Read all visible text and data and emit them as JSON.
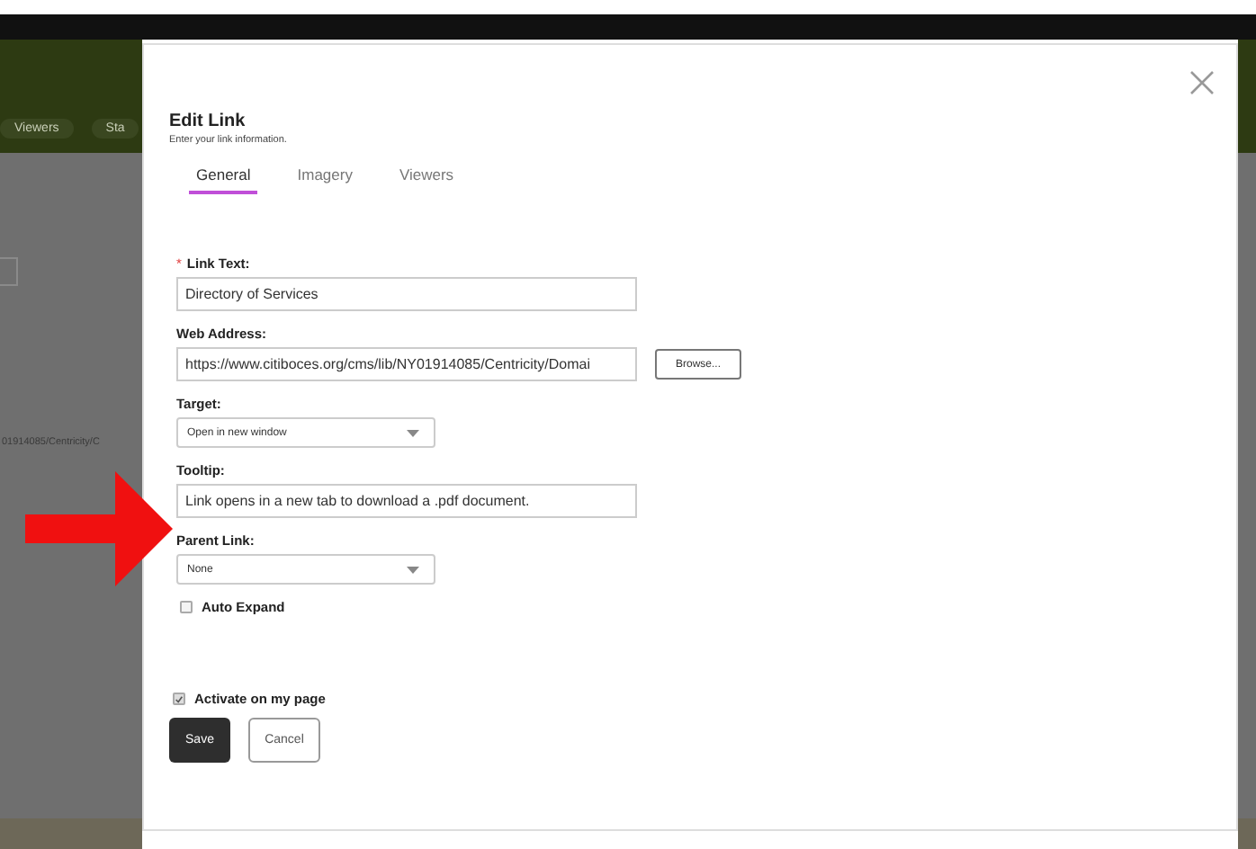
{
  "background": {
    "nav_tabs": [
      "Viewers",
      "Sta"
    ],
    "path_text": "01914085/Centricity/C"
  },
  "dialog": {
    "title": "Edit Link",
    "subtitle": "Enter your link information.",
    "tabs": [
      {
        "label": "General",
        "selected": true
      },
      {
        "label": "Imagery",
        "selected": false
      },
      {
        "label": "Viewers",
        "selected": false
      }
    ],
    "fields": [
      {
        "kind": "text",
        "label": "Link Text:",
        "required_mark": "*",
        "value": "Directory of Services"
      },
      {
        "kind": "text",
        "label": "Web Address:",
        "value": "https://www.citiboces.org/cms/lib/NY01914085/Centricity/Domai",
        "button": "Browse..."
      },
      {
        "kind": "select",
        "label": "Target:",
        "value": "Open in new window"
      },
      {
        "kind": "text",
        "label": "Tooltip:",
        "value": "Link opens in a new tab to download a .pdf document."
      },
      {
        "kind": "select",
        "label": "Parent Link:",
        "value": "None"
      },
      {
        "kind": "checkbox",
        "label": "Auto Expand",
        "checked": false
      }
    ],
    "activate": {
      "label": "Activate on my page",
      "checked": true
    },
    "buttons": [
      {
        "label": "Save",
        "kind": "primary"
      },
      {
        "label": "Cancel",
        "kind": "secondary"
      }
    ]
  }
}
